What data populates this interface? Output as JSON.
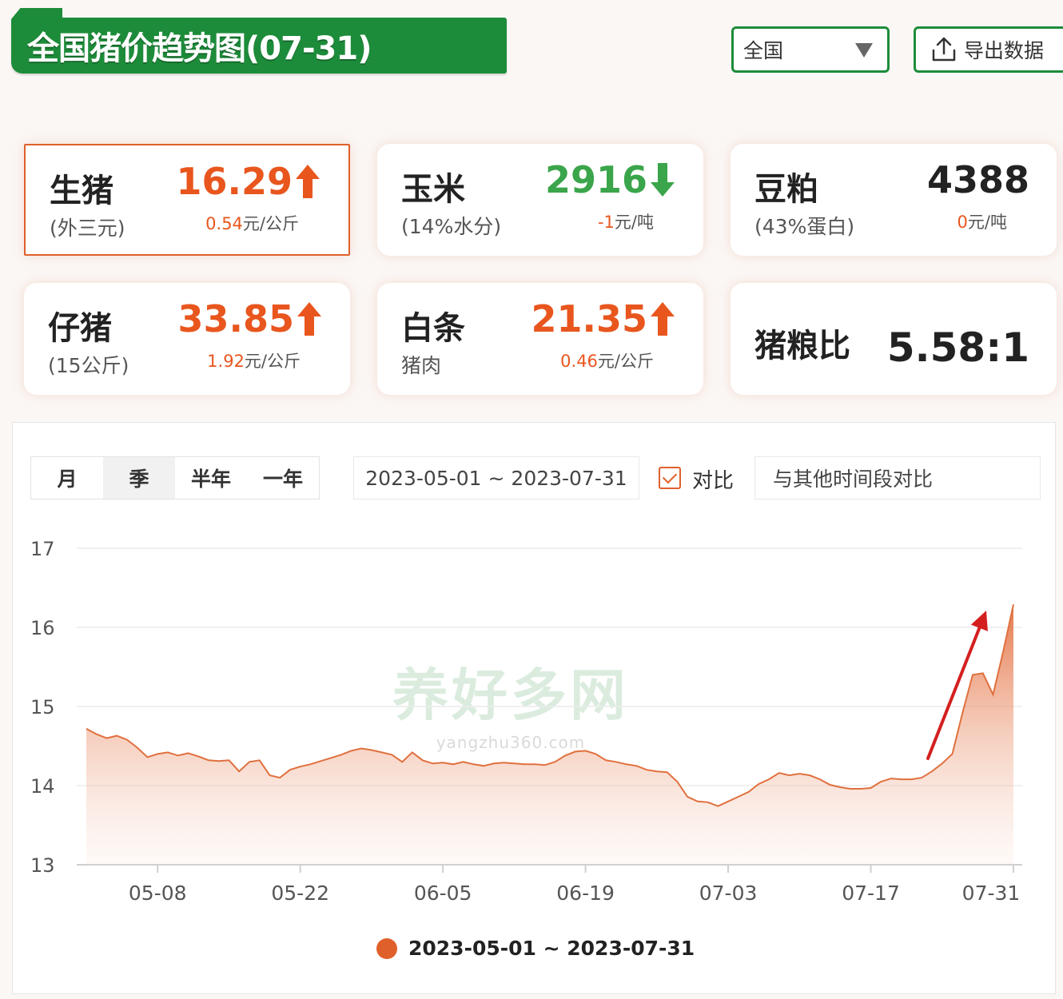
{
  "header": {
    "title": "全国猪价趋势图(07-31)",
    "region": "全国",
    "export_label": "导出数据"
  },
  "cards": [
    {
      "name": "生猪",
      "sub": "(外三元)",
      "value": "16.29",
      "trend": "up",
      "change_num": "0.54",
      "change_unit": "元/公斤",
      "active": true
    },
    {
      "name": "玉米",
      "sub": "(14%水分)",
      "value": "2916",
      "trend": "down",
      "change_num": "-1",
      "change_unit": "元/吨",
      "active": false
    },
    {
      "name": "豆粕",
      "sub": "(43%蛋白)",
      "value": "4388",
      "trend": "flat",
      "change_num": "0",
      "change_unit": "元/吨",
      "active": false
    },
    {
      "name": "仔猪",
      "sub": "(15公斤)",
      "value": "33.85",
      "trend": "up",
      "change_num": "1.92",
      "change_unit": "元/公斤",
      "active": false
    },
    {
      "name": "白条",
      "sub": "猪肉",
      "value": "21.35",
      "trend": "up",
      "change_num": "0.46",
      "change_unit": "元/公斤",
      "active": false
    }
  ],
  "ratio_card": {
    "name": "猪粮比",
    "value": "5.58:1"
  },
  "controls": {
    "periods": [
      "月",
      "季",
      "半年",
      "一年"
    ],
    "active_period": "季",
    "date_range": "2023-05-01 ~ 2023-07-31",
    "compare_label": "对比",
    "compare_checked": true,
    "compare_placeholder": "与其他时间段对比"
  },
  "watermark": {
    "main": "养好多网",
    "sub": "yangzhu360.com"
  },
  "colors": {
    "brand_green": "#1d8c3a",
    "accent_orange": "#e0602b",
    "up_red": "#e8561e",
    "down_green": "#3aa54a"
  },
  "chart_data": {
    "type": "area",
    "title": "",
    "xlabel": "",
    "ylabel": "",
    "ylim": [
      13,
      17
    ],
    "yticks": [
      13,
      14,
      15,
      16,
      17
    ],
    "xticks": [
      "05-08",
      "05-22",
      "06-05",
      "06-19",
      "07-03",
      "07-17",
      "07-31"
    ],
    "grid": true,
    "legend_position": "bottom",
    "series": [
      {
        "name": "2023-05-01 ~ 2023-07-31",
        "x": [
          "05-01",
          "05-02",
          "05-03",
          "05-04",
          "05-05",
          "05-06",
          "05-07",
          "05-08",
          "05-09",
          "05-10",
          "05-11",
          "05-12",
          "05-13",
          "05-14",
          "05-15",
          "05-16",
          "05-17",
          "05-18",
          "05-19",
          "05-20",
          "05-21",
          "05-22",
          "05-23",
          "05-24",
          "05-25",
          "05-26",
          "05-27",
          "05-28",
          "05-29",
          "05-30",
          "05-31",
          "06-01",
          "06-02",
          "06-03",
          "06-04",
          "06-05",
          "06-06",
          "06-07",
          "06-08",
          "06-09",
          "06-10",
          "06-11",
          "06-12",
          "06-13",
          "06-14",
          "06-15",
          "06-16",
          "06-17",
          "06-18",
          "06-19",
          "06-20",
          "06-21",
          "06-22",
          "06-23",
          "06-24",
          "06-25",
          "06-26",
          "06-27",
          "06-28",
          "06-29",
          "06-30",
          "07-01",
          "07-02",
          "07-03",
          "07-04",
          "07-05",
          "07-06",
          "07-07",
          "07-08",
          "07-09",
          "07-10",
          "07-11",
          "07-12",
          "07-13",
          "07-14",
          "07-15",
          "07-16",
          "07-17",
          "07-18",
          "07-19",
          "07-20",
          "07-21",
          "07-22",
          "07-23",
          "07-24",
          "07-25",
          "07-26",
          "07-27",
          "07-28",
          "07-29",
          "07-30",
          "07-31"
        ],
        "values": [
          14.72,
          14.65,
          14.6,
          14.63,
          14.58,
          14.48,
          14.36,
          14.4,
          14.42,
          14.38,
          14.41,
          14.37,
          14.32,
          14.31,
          14.32,
          14.18,
          14.3,
          14.32,
          14.13,
          14.1,
          14.2,
          14.24,
          14.27,
          14.31,
          14.35,
          14.39,
          14.44,
          14.47,
          14.45,
          14.42,
          14.39,
          14.3,
          14.42,
          14.32,
          14.28,
          14.29,
          14.27,
          14.3,
          14.27,
          14.25,
          14.28,
          14.29,
          14.28,
          14.27,
          14.27,
          14.26,
          14.3,
          14.38,
          14.43,
          14.44,
          14.4,
          14.32,
          14.3,
          14.27,
          14.25,
          14.2,
          14.18,
          14.17,
          14.05,
          13.86,
          13.8,
          13.79,
          13.74,
          13.8,
          13.86,
          13.92,
          14.02,
          14.08,
          14.16,
          14.13,
          14.15,
          14.13,
          14.08,
          14.01,
          13.98,
          13.96,
          13.96,
          13.97,
          14.05,
          14.09,
          14.08,
          14.08,
          14.1,
          14.18,
          14.28,
          14.4,
          14.92,
          15.4,
          15.42,
          15.15,
          15.7,
          16.29
        ]
      }
    ]
  }
}
